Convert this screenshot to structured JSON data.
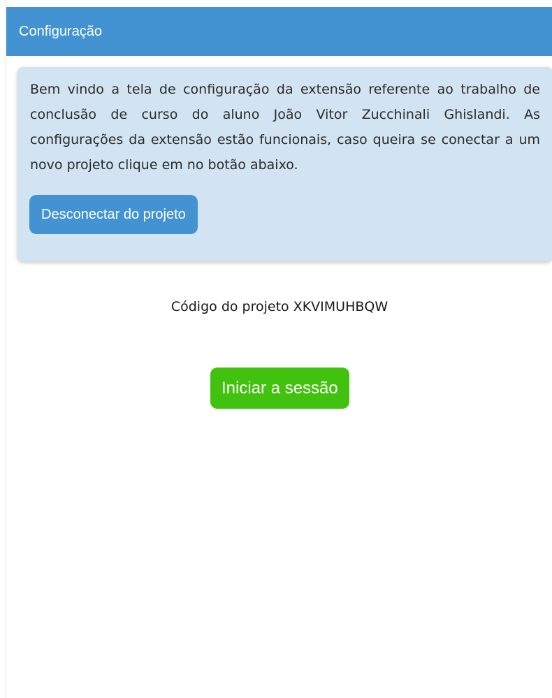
{
  "header": {
    "title": "Configuração"
  },
  "info_card": {
    "text": "Bem vindo a tela de configuração da extensão referente ao trabalho de conclusão de curso do aluno João Vitor Zucchinali Ghislandi. As configurações da extensão estão funcionais, caso queira se conectar a um novo projeto clique em no botão abaixo.",
    "disconnect_label": "Desconectar do projeto"
  },
  "project": {
    "code_text": "Código do projeto XKVIMUHBQW"
  },
  "actions": {
    "start_label": "Iniciar a sessão"
  },
  "colors": {
    "header_bg": "#4393d3",
    "card_bg": "#d2e3f1",
    "primary_button": "#4393d3",
    "start_button": "#41c20e"
  }
}
